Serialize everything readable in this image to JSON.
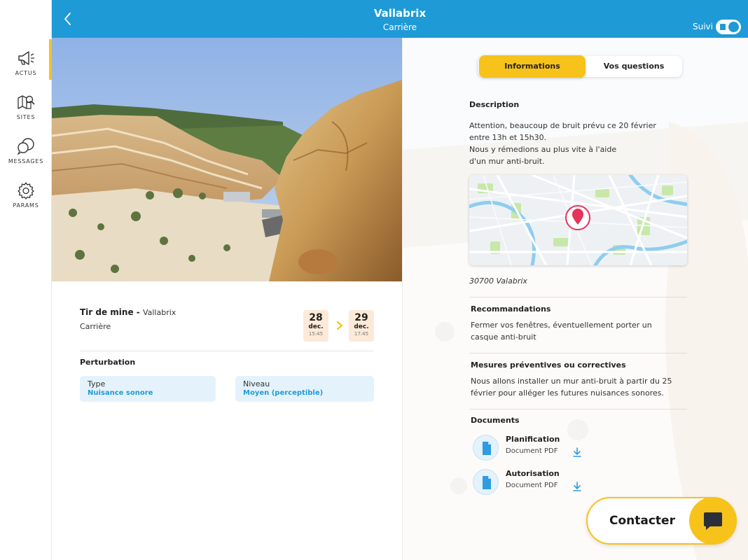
{
  "sidebar": {
    "items": [
      {
        "label": "ACTUS",
        "icon": "megaphone-icon"
      },
      {
        "label": "SITES",
        "icon": "map-search-icon"
      },
      {
        "label": "MESSAGES",
        "icon": "chat-bubbles-icon"
      },
      {
        "label": "PARAMS",
        "icon": "gear-icon"
      }
    ]
  },
  "header": {
    "title": "Vallabrix",
    "subtitle": "Carrière",
    "follow_label": "Suivi",
    "follow_on": true
  },
  "event": {
    "type": "Tir de mine -",
    "location": "Vallabrix",
    "category": "Carrière",
    "start": {
      "day": "28",
      "month": "dec.",
      "time": "15:45"
    },
    "end": {
      "day": "29",
      "month": "dec.",
      "time": "17:45"
    }
  },
  "perturbation": {
    "title": "Perturbation",
    "type_label": "Type",
    "type_value": "Nuisance sonore",
    "level_label": "Niveau",
    "level_value": "Moyen (perceptible)"
  },
  "tabs": {
    "info": "Informations",
    "questions": "Vos questions"
  },
  "description": {
    "title": "Description",
    "lines": [
      "Attention, beaucoup de bruit prévu ce 20 février",
      "entre 13h et 15h30.",
      "Nous y rémedions au plus vite à l'aide",
      "d'un mur anti-bruit."
    ]
  },
  "address": "30700 Valabrix",
  "recommendations": {
    "title": "Recommandations",
    "lines": [
      "Fermer vos fenêtres, éventuellement porter un",
      "casque anti-bruit"
    ]
  },
  "measures": {
    "title": "Mesures préventives ou correctives",
    "lines": [
      "Nous allons installer un mur anti-bruit à partir du 25",
      "février pour alléger les futures nuisances sonores."
    ]
  },
  "documents": {
    "title": "Documents",
    "items": [
      {
        "name": "Planification",
        "type": "Document PDF"
      },
      {
        "name": "Autorisation",
        "type": "Document PDF"
      }
    ]
  },
  "contact": {
    "label": "Contacter"
  },
  "colors": {
    "primary": "#1e9ad6",
    "accent": "#f7c21a",
    "chip": "#e4f2fc",
    "date_box": "#fde9d8"
  }
}
